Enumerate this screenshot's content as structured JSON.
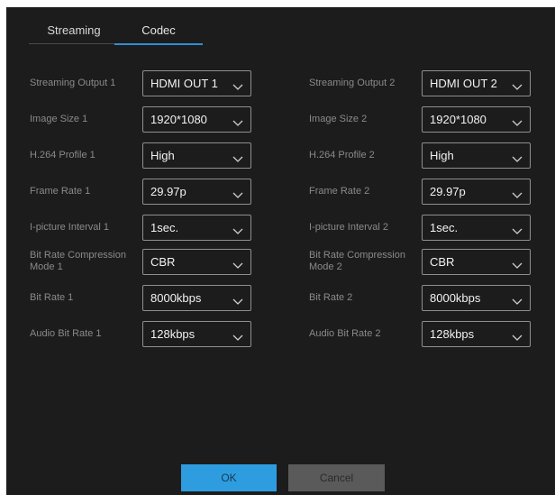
{
  "tabs": [
    {
      "label": "Streaming"
    },
    {
      "label": "Codec"
    }
  ],
  "left": [
    {
      "label": "Streaming Output 1",
      "value": "HDMI OUT 1"
    },
    {
      "label": "Image Size 1",
      "value": "1920*1080"
    },
    {
      "label": "H.264 Profile 1",
      "value": "High"
    },
    {
      "label": "Frame Rate 1",
      "value": "29.97p"
    },
    {
      "label": "I-picture Interval 1",
      "value": "1sec."
    },
    {
      "label": "Bit Rate Compression\nMode 1",
      "value": "CBR"
    },
    {
      "label": "Bit Rate 1",
      "value": "8000kbps"
    },
    {
      "label": "Audio Bit Rate 1",
      "value": "128kbps"
    }
  ],
  "right": [
    {
      "label": "Streaming Output 2",
      "value": "HDMI OUT 2"
    },
    {
      "label": "Image Size 2",
      "value": "1920*1080"
    },
    {
      "label": "H.264 Profile 2",
      "value": "High"
    },
    {
      "label": "Frame Rate 2",
      "value": "29.97p"
    },
    {
      "label": "I-picture Interval 2",
      "value": "1sec."
    },
    {
      "label": "Bit Rate Compression\nMode 2",
      "value": "CBR"
    },
    {
      "label": "Bit Rate 2",
      "value": "8000kbps"
    },
    {
      "label": "Audio Bit Rate 2",
      "value": "128kbps"
    }
  ],
  "buttons": {
    "ok": "OK",
    "cancel": "Cancel"
  },
  "colors": {
    "accent": "#2e9de0",
    "background": "#1c1c1c"
  },
  "icons": {
    "dropdown": "chevron-down-icon"
  }
}
